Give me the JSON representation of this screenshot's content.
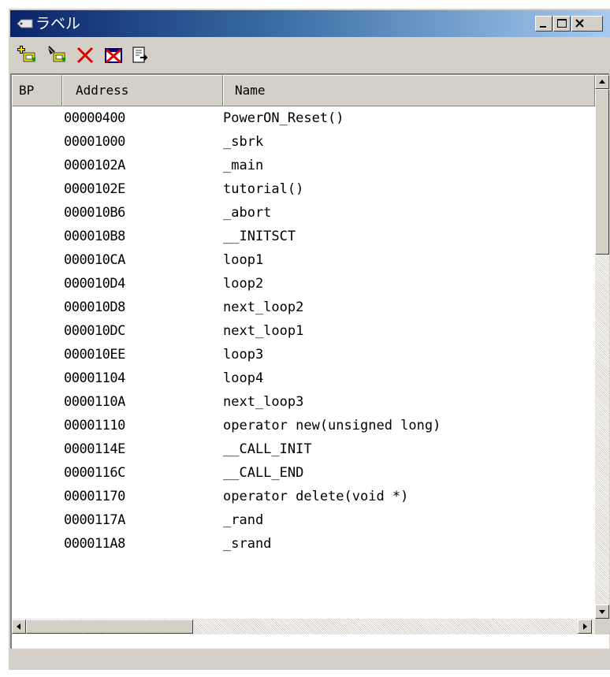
{
  "window": {
    "title": "ラベル",
    "title_icon": "label-window-icon",
    "controls": [
      "minimize-icon",
      "maximize-icon",
      "close-icon"
    ]
  },
  "toolbar": {
    "buttons": [
      {
        "icon": "add-label-icon"
      },
      {
        "icon": "edit-label-icon"
      },
      {
        "icon": "delete-label-icon"
      },
      {
        "icon": "delete-all-labels-icon"
      },
      {
        "icon": "export-labels-icon"
      }
    ]
  },
  "table": {
    "columns": [
      "BP",
      "Address",
      "Name"
    ],
    "rows": [
      {
        "address": "00000400",
        "name": "PowerON_Reset()"
      },
      {
        "address": "00001000",
        "name": "_sbrk"
      },
      {
        "address": "0000102A",
        "name": "_main"
      },
      {
        "address": "0000102E",
        "name": "tutorial()"
      },
      {
        "address": "000010B6",
        "name": "_abort"
      },
      {
        "address": "000010B8",
        "name": "__INITSCT"
      },
      {
        "address": "000010CA",
        "name": "loop1"
      },
      {
        "address": "000010D4",
        "name": "loop2"
      },
      {
        "address": "000010D8",
        "name": "next_loop2"
      },
      {
        "address": "000010DC",
        "name": "next_loop1"
      },
      {
        "address": "000010EE",
        "name": "loop3"
      },
      {
        "address": "00001104",
        "name": "loop4"
      },
      {
        "address": "0000110A",
        "name": "next_loop3"
      },
      {
        "address": "00001110",
        "name": "operator new(unsigned long)"
      },
      {
        "address": "0000114E",
        "name": "__CALL_INIT"
      },
      {
        "address": "0000116C",
        "name": "__CALL_END"
      },
      {
        "address": "00001170",
        "name": "operator delete(void *)"
      },
      {
        "address": "0000117A",
        "name": "_rand"
      },
      {
        "address": "000011A8",
        "name": "_srand"
      }
    ]
  },
  "colors": {
    "titlebar_start": "#0a246a",
    "titlebar_end": "#a6caf0",
    "chrome": "#d4d0c8"
  }
}
